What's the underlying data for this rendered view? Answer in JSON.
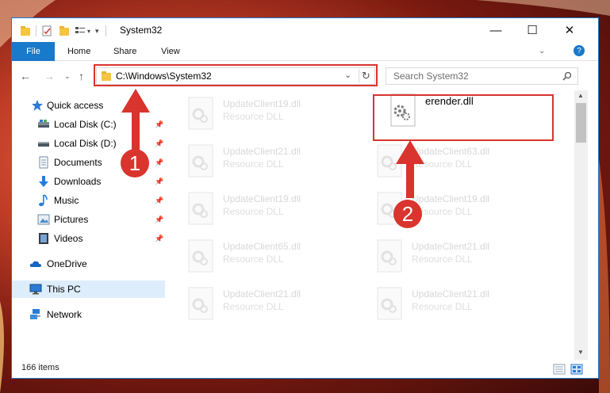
{
  "window": {
    "title": "System32",
    "minimize": "—",
    "maximize": "☐",
    "close": "✕"
  },
  "ribbon": {
    "file": "File",
    "tabs": [
      "Home",
      "Share",
      "View"
    ],
    "help": "?"
  },
  "nav": {
    "address": "C:\\Windows\\System32",
    "search_placeholder": "Search System32"
  },
  "sidebar": {
    "items": [
      {
        "label": "Quick access",
        "icon": "star-icon",
        "pinned": false
      },
      {
        "label": "Local Disk (C:)",
        "icon": "drive-icon",
        "pinned": true
      },
      {
        "label": "Local Disk (D:)",
        "icon": "drive-icon",
        "pinned": true
      },
      {
        "label": "Documents",
        "icon": "documents-icon",
        "pinned": true
      },
      {
        "label": "Downloads",
        "icon": "downloads-icon",
        "pinned": true
      },
      {
        "label": "Music",
        "icon": "music-icon",
        "pinned": true
      },
      {
        "label": "Pictures",
        "icon": "pictures-icon",
        "pinned": true
      },
      {
        "label": "Videos",
        "icon": "videos-icon",
        "pinned": true
      },
      {
        "label": "OneDrive",
        "icon": "cloud-icon",
        "pinned": false
      },
      {
        "label": "This PC",
        "icon": "pc-icon",
        "pinned": false,
        "selected": true
      },
      {
        "label": "Network",
        "icon": "network-icon",
        "pinned": false
      }
    ]
  },
  "files": [
    {
      "name": "UpdateClient19.dll",
      "type": "Resource DLL"
    },
    {
      "name": "erender.dll",
      "type": ""
    },
    {
      "name": "UpdateClient21.dll",
      "type": "Resource DLL"
    },
    {
      "name": "UpdateClient63.dll",
      "type": "Resource DLL"
    },
    {
      "name": "UpdateClient19.dll",
      "type": "Resource DLL"
    },
    {
      "name": "UpdateClient19.dll",
      "type": "Resource DLL"
    },
    {
      "name": "UpdateClient65.dll",
      "type": "Resource DLL"
    },
    {
      "name": "UpdateClient21.dll",
      "type": "Resource DLL"
    },
    {
      "name": "UpdateClient21.dll",
      "type": "Resource DLL"
    },
    {
      "name": "UpdateClient21.dll",
      "type": "Resource DLL"
    }
  ],
  "status": {
    "count": "166 items"
  },
  "callouts": [
    "1",
    "2"
  ],
  "colors": {
    "accent": "#1979ca",
    "highlight": "#d9342e"
  }
}
